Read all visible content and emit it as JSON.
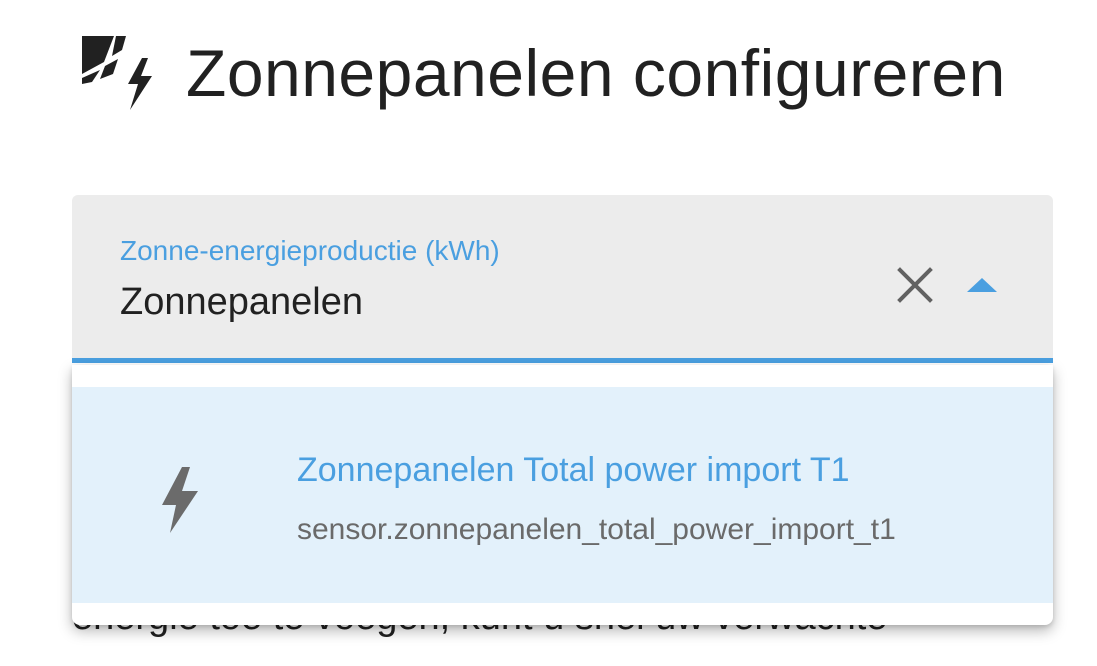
{
  "header": {
    "icon": "solar-power-icon",
    "title": "Zonnepanelen configureren"
  },
  "select": {
    "label": "Zonne-energieproductie (kWh)",
    "value": "Zonnepanelen",
    "clear_icon": "close-icon",
    "toggle_icon": "caret-up-icon",
    "accent_color": "#4a9fe0"
  },
  "dropdown": {
    "options": [
      {
        "icon": "flash-icon",
        "primary": "Zonnepanelen Total power import T1",
        "secondary": "sensor.zonnepanelen_total_power_import_t1"
      }
    ]
  },
  "background_text": "energie toe te voegen, kunt u snel uw verwachte"
}
